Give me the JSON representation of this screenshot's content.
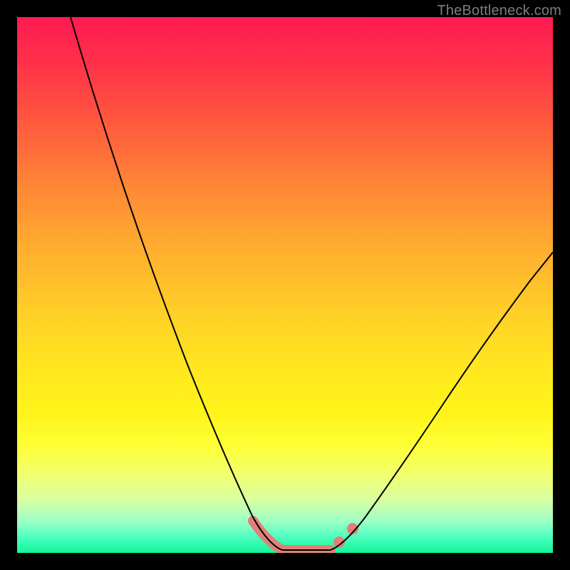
{
  "watermark": "TheBottleneck.com",
  "chart_data": {
    "type": "line",
    "title": "",
    "xlabel": "",
    "ylabel": "",
    "xlim": [
      0,
      100
    ],
    "ylim": [
      0,
      100
    ],
    "grid": false,
    "legend": false,
    "background": "vertical-gradient",
    "gradient_stops": [
      {
        "pos": 0.0,
        "color": "#ff1a52"
      },
      {
        "pos": 0.2,
        "color": "#ff5a3e"
      },
      {
        "pos": 0.44,
        "color": "#ffb02f"
      },
      {
        "pos": 0.66,
        "color": "#ffe81f"
      },
      {
        "pos": 0.85,
        "color": "#f2ff6a"
      },
      {
        "pos": 1.0,
        "color": "#11f59a"
      }
    ],
    "series": [
      {
        "name": "left-curve",
        "x": [
          10,
          15,
          20,
          25,
          30,
          35,
          40,
          44,
          47,
          49.5
        ],
        "y": [
          100,
          82,
          65,
          49,
          35,
          23,
          13,
          6,
          2,
          0.5
        ]
      },
      {
        "name": "valley-floor",
        "x": [
          49.5,
          51,
          53,
          55,
          57,
          58.5
        ],
        "y": [
          0.5,
          0.3,
          0.3,
          0.3,
          0.4,
          0.6
        ]
      },
      {
        "name": "right-curve",
        "x": [
          58.5,
          61,
          65,
          70,
          76,
          83,
          90,
          96,
          100
        ],
        "y": [
          0.6,
          2.5,
          7,
          14,
          24,
          36,
          47,
          56,
          61
        ]
      }
    ],
    "highlight_segments": [
      {
        "name": "left-descent-band",
        "x": [
          44,
          49.5
        ],
        "y": [
          6,
          0.5
        ]
      },
      {
        "name": "valley-band",
        "x": [
          49.5,
          58.5
        ],
        "y": [
          0.5,
          0.6
        ]
      },
      {
        "name": "right-ascent-dot-1",
        "x": [
          60
        ],
        "y": [
          2
        ]
      },
      {
        "name": "right-ascent-dot-2",
        "x": [
          62.5
        ],
        "y": [
          4.5
        ]
      }
    ]
  }
}
